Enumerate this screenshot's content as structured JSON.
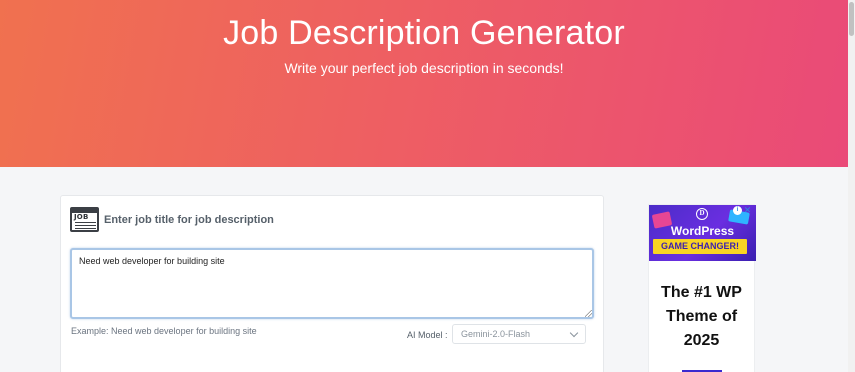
{
  "hero": {
    "title": "Job Description Generator",
    "subtitle": "Write your perfect job description in seconds!"
  },
  "card": {
    "icon_text": "JOB",
    "heading": "Enter job title for job description",
    "input_value": "Need web developer for building site",
    "example": "Example: Need web developer for building site",
    "model_label": "AI Model :",
    "model_selected": "Gemini-2.0-Flash"
  },
  "ad": {
    "wordpress": "WordPress",
    "chip": "GAME CHANGER!",
    "tagline_line1": "The #1 WP",
    "tagline_line2": "Theme of",
    "tagline_line3": "2025"
  },
  "colors": {
    "gradient_start": "#f0714f",
    "gradient_end": "#ea4a78",
    "ad_purple": "#4b2cc8",
    "ad_yellow": "#f9d423"
  }
}
